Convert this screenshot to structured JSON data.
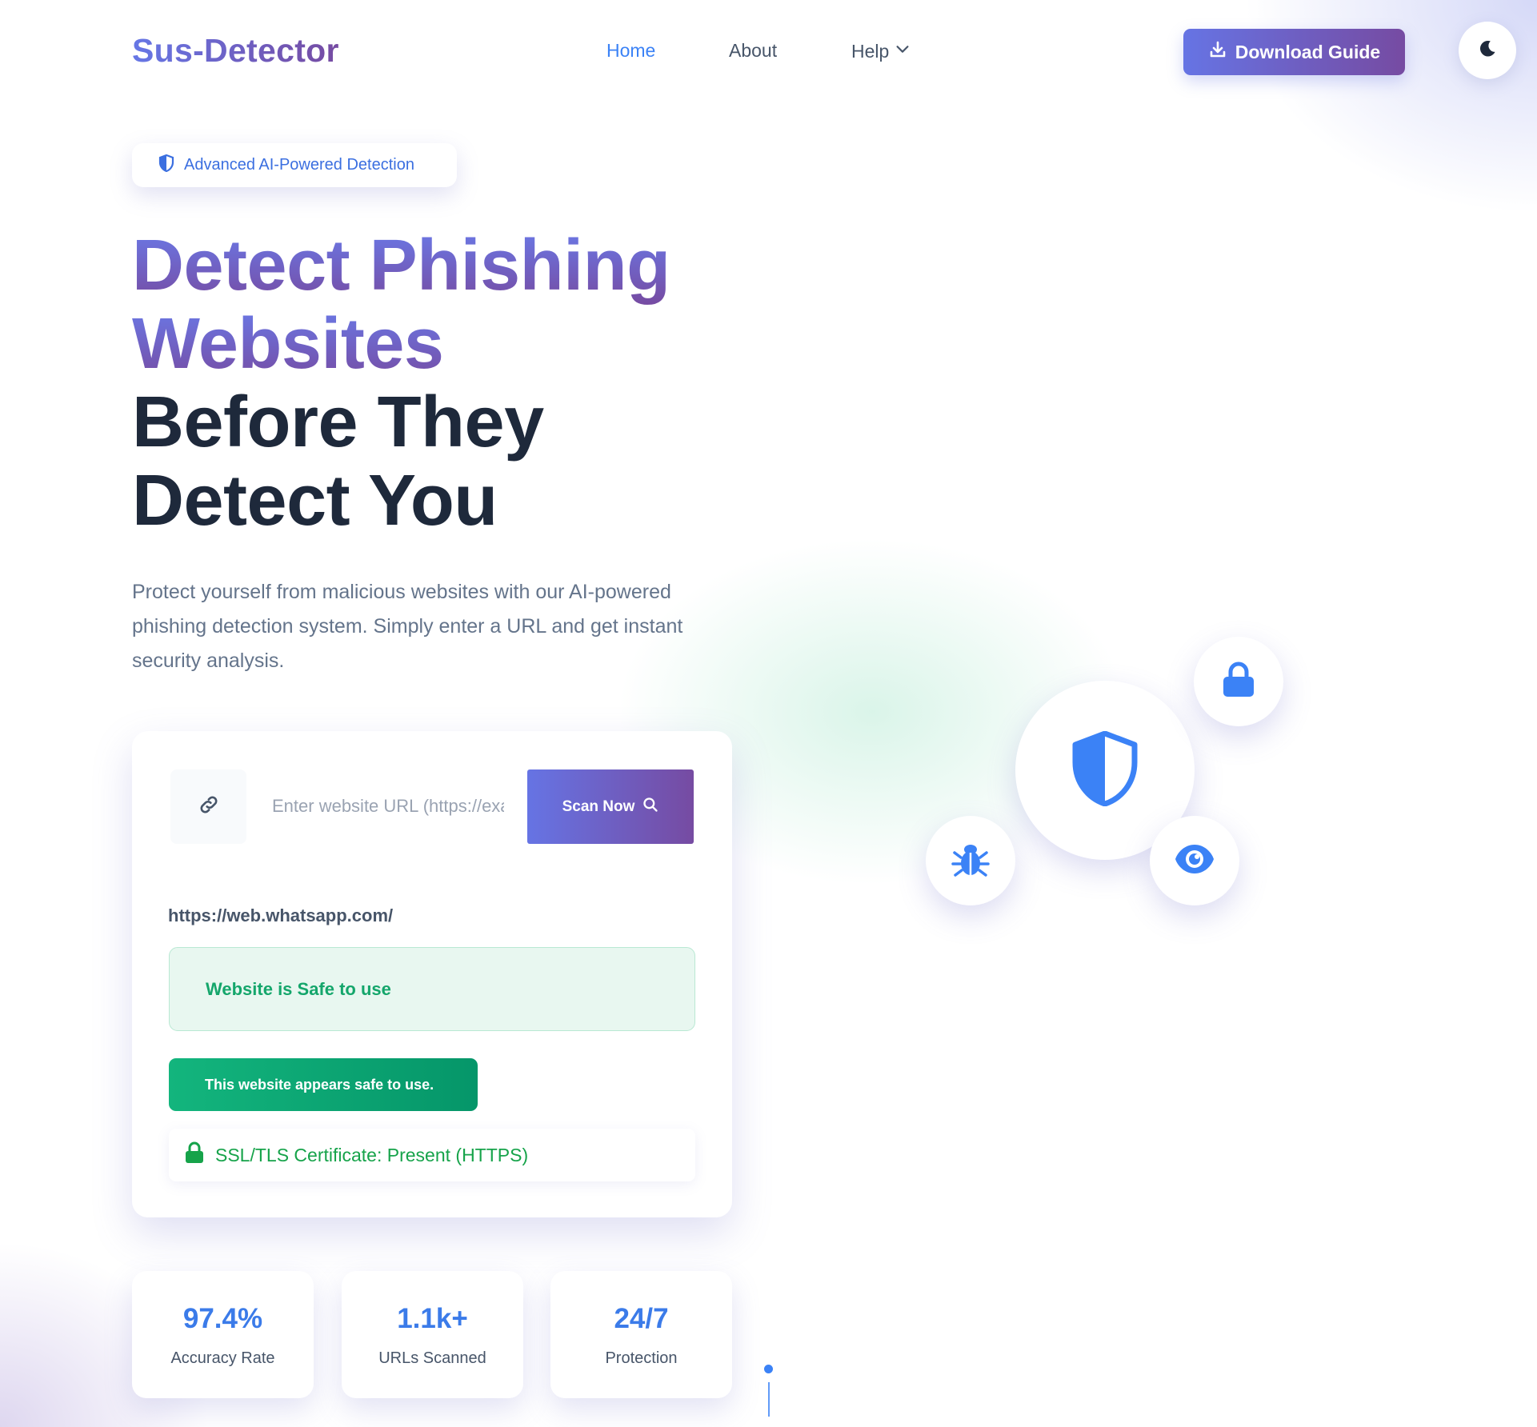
{
  "nav": {
    "logo": "Sus-Detector",
    "links": [
      {
        "label": "Home",
        "active": true
      },
      {
        "label": "About",
        "active": false
      },
      {
        "label": "Help",
        "active": false
      }
    ],
    "download_label": "Download Guide",
    "theme_icon": "moon-icon"
  },
  "hero": {
    "badge": "Advanced AI-Powered Detection",
    "headline": {
      "line1": "Detect Phishing",
      "line2": "Websites",
      "line3": "Before They",
      "line4": "Detect You"
    },
    "subtitle": "Protect yourself from malicious websites with our AI-powered phishing detection system. Simply enter a URL and get instant security analysis."
  },
  "scan": {
    "input_placeholder": "Enter website URL (https://example.com)",
    "input_value": "",
    "scan_label": "Scan Now",
    "scanned_url": "https://web.whatsapp.com/",
    "result_text": "Website is Safe to use",
    "safe_message": "This website appears safe to use.",
    "ssl_text": "SSL/TLS Certificate: Present (HTTPS)"
  },
  "stats": [
    {
      "value": "97.4%",
      "label": "Accuracy Rate"
    },
    {
      "value": "1.1k+",
      "label": "URLs Scanned"
    },
    {
      "value": "24/7",
      "label": "Protection"
    }
  ],
  "floating_icons": [
    "shield-icon",
    "lock-icon",
    "bug-icon",
    "eye-icon"
  ],
  "colors": {
    "accent": "#3b82f6",
    "brand_start": "#667eea",
    "brand_end": "#764ba2",
    "safe_green": "#10b981",
    "heading_dark": "#1e293b"
  }
}
